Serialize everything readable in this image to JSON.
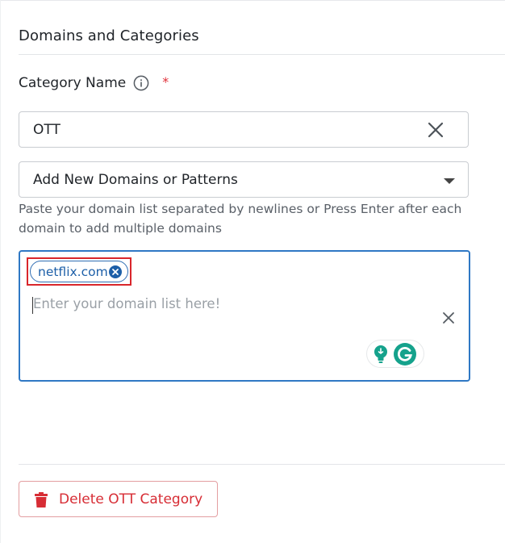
{
  "section": {
    "title": "Domains and Categories"
  },
  "category_field": {
    "label": "Category Name",
    "required_mark": "*",
    "value": "OTT"
  },
  "domain_select": {
    "selected": "Add New Domains or Patterns"
  },
  "helper_text": "Paste your domain list separated by newlines or Press Enter after each domain to add multiple domains",
  "domain_entry": {
    "chips": [
      "netflix.com"
    ],
    "placeholder": "Enter your domain list here!"
  },
  "actions": {
    "delete_label": "Delete OTT Category"
  },
  "colors": {
    "accent_blue": "#2f78c4",
    "danger_red": "#d72d35",
    "highlight_red": "#d9262b",
    "grammarly_green": "#15a28c"
  }
}
